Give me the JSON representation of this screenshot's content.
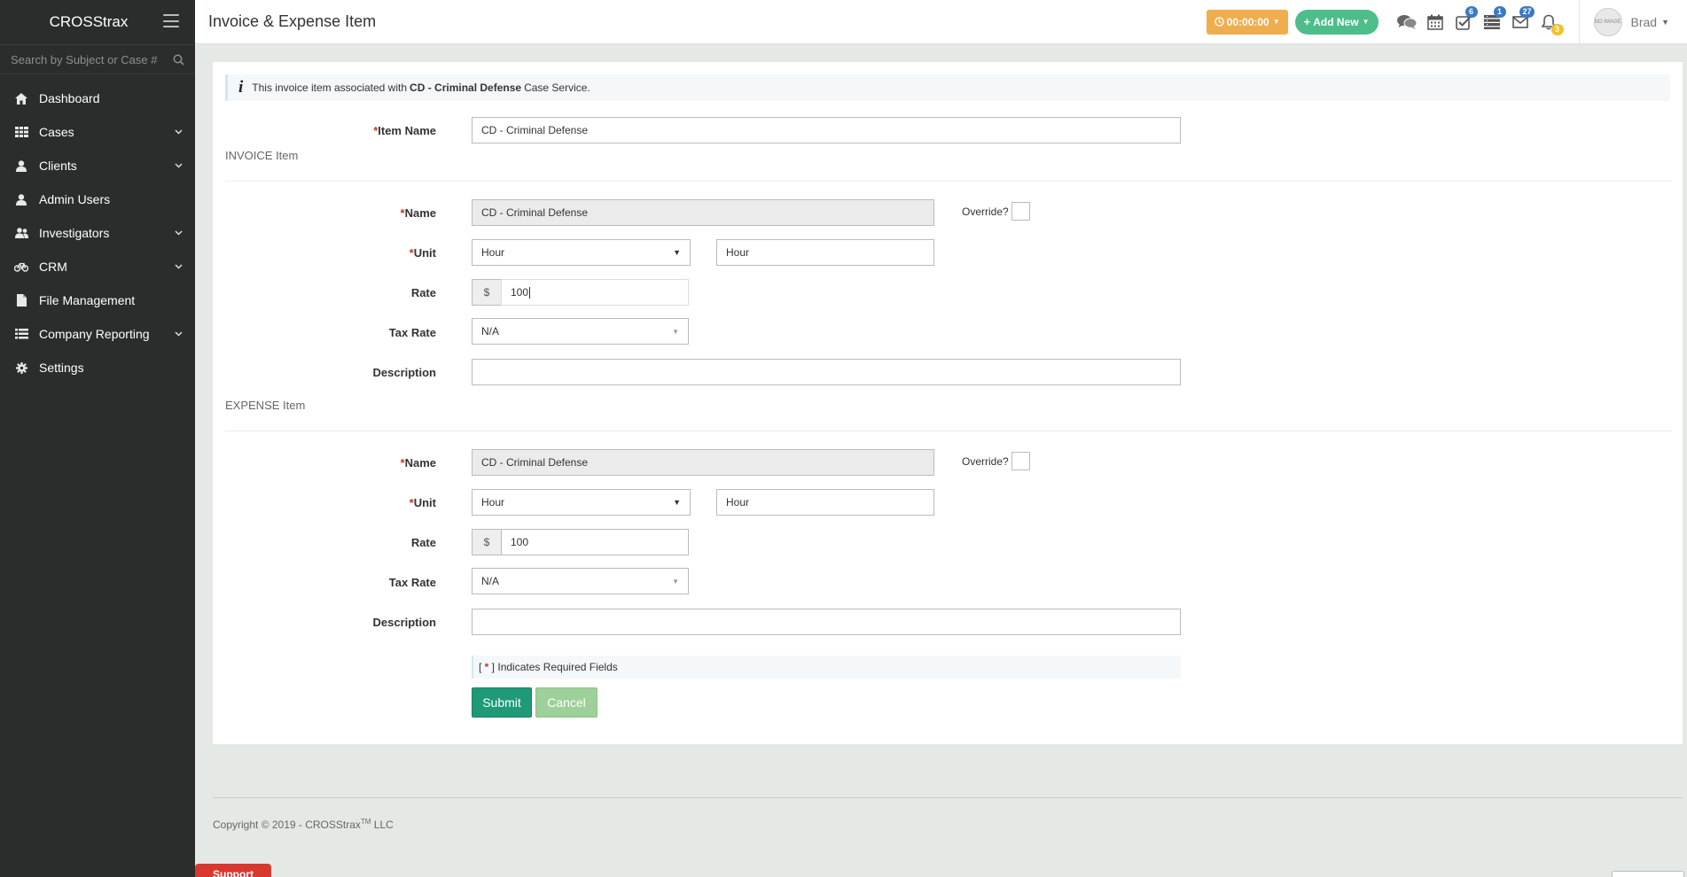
{
  "sidebar": {
    "brand": "CROSStrax",
    "search_placeholder": "Search by Subject or Case #",
    "items": [
      {
        "label": "Dashboard",
        "icon": "home-icon",
        "has_caret": false
      },
      {
        "label": "Cases",
        "icon": "grid-icon",
        "has_caret": true
      },
      {
        "label": "Clients",
        "icon": "user-icon",
        "has_caret": true
      },
      {
        "label": "Admin Users",
        "icon": "user-icon",
        "has_caret": false
      },
      {
        "label": "Investigators",
        "icon": "users-icon",
        "has_caret": true
      },
      {
        "label": "CRM",
        "icon": "bicycle-icon",
        "has_caret": true
      },
      {
        "label": "File Management",
        "icon": "file-icon",
        "has_caret": false
      },
      {
        "label": "Company Reporting",
        "icon": "list-icon",
        "has_caret": true
      },
      {
        "label": "Settings",
        "icon": "gear-icon",
        "has_caret": false
      }
    ]
  },
  "header": {
    "title": "Invoice & Expense Item",
    "timer_label": "00:00:00",
    "add_new_label": "Add New",
    "badges": {
      "tasks": "6",
      "list": "1",
      "mail": "27",
      "notifications": "3"
    },
    "user_name": "Brad",
    "avatar_text": "NO IMAGE"
  },
  "form": {
    "info_prefix": "This invoice item associated with",
    "info_case": "CD - Criminal Defense",
    "info_suffix": "Case Service.",
    "item_name_label": "Item Name",
    "item_name_value": "CD - Criminal Defense",
    "invoice": {
      "section_title": "INVOICE Item",
      "name_label": "Name",
      "name_value": "CD - Criminal Defense",
      "override_label": "Override?",
      "unit_label": "Unit",
      "unit_select": "Hour",
      "unit_text": "Hour",
      "rate_label": "Rate",
      "currency": "$",
      "rate_value": "100",
      "tax_label": "Tax Rate",
      "tax_value": "N/A",
      "description_label": "Description",
      "description_value": ""
    },
    "expense": {
      "section_title": "EXPENSE Item",
      "name_label": "Name",
      "name_value": "CD - Criminal Defense",
      "override_label": "Override?",
      "unit_label": "Unit",
      "unit_select": "Hour",
      "unit_text": "Hour",
      "rate_label": "Rate",
      "currency": "$",
      "rate_value": "100",
      "tax_label": "Tax Rate",
      "tax_value": "N/A",
      "description_label": "Description",
      "description_value": ""
    },
    "required_note": "Indicates Required Fields",
    "required_star": "*",
    "submit_label": "Submit",
    "cancel_label": "Cancel"
  },
  "footer": {
    "copyright": "Copyright © 2019 - CROSStrax",
    "tm": "TM",
    "llc": " LLC",
    "support_label": "Support"
  },
  "colors": {
    "sidebar_bg": "#2b2d2d",
    "timer_bg": "#f0ad4e",
    "add_new_bg": "#4dbd8a",
    "submit_bg": "#1e9a78",
    "cancel_bg": "#9ed09a",
    "required": "#c0392b"
  }
}
